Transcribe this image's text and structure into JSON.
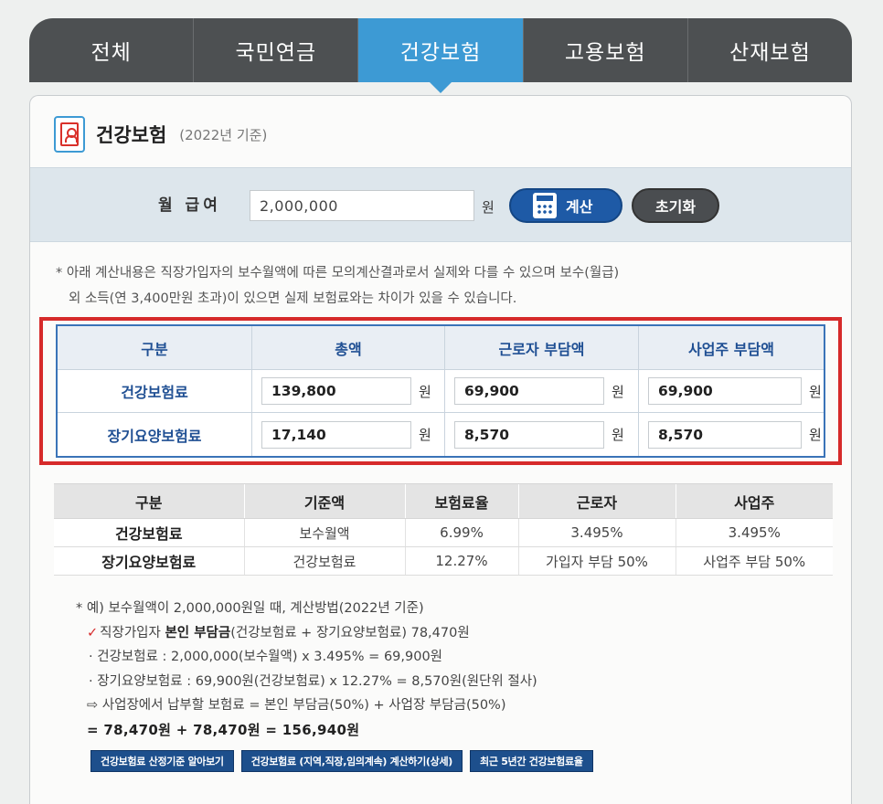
{
  "tabs": [
    {
      "label": "전체",
      "active": false
    },
    {
      "label": "국민연금",
      "active": false
    },
    {
      "label": "건강보험",
      "active": true
    },
    {
      "label": "고용보험",
      "active": false
    },
    {
      "label": "산재보험",
      "active": false
    }
  ],
  "header": {
    "title": "건강보험",
    "subtitle": "(2022년 기준)"
  },
  "calc": {
    "label": "월 급여",
    "salary_value": "2,000,000",
    "unit": "원",
    "calc_button": "계산",
    "reset_button": "초기화"
  },
  "notice": {
    "line1": "* 아래 계산내용은 직장가입자의 보수월액에 따른 모의계산결과로서 실제와 다를 수 있으며 보수(월급)",
    "line2": "외 소득(연 3,400만원 초과)이 있으면 실제 보험료와는 차이가 있을 수 있습니다."
  },
  "result": {
    "headers": [
      "구분",
      "총액",
      "근로자 부담액",
      "사업주 부담액"
    ],
    "unit": "원",
    "rows": [
      {
        "label": "건강보험료",
        "total": "139,800",
        "worker": "69,900",
        "employer": "69,900"
      },
      {
        "label": "장기요양보험료",
        "total": "17,140",
        "worker": "8,570",
        "employer": "8,570"
      }
    ]
  },
  "rates": {
    "headers": [
      "구분",
      "기준액",
      "보험료율",
      "근로자",
      "사업주"
    ],
    "rows": [
      [
        "건강보험료",
        "보수월액",
        "6.99%",
        "3.495%",
        "3.495%"
      ],
      [
        "장기요양보험료",
        "건강보험료",
        "12.27%",
        "가입자 부담 50%",
        "사업주 부담 50%"
      ]
    ]
  },
  "example": {
    "line1": "* 예) 보수월액이 2,000,000원일 때, 계산방법(2022년 기준)",
    "line2_mark": "✓",
    "line2_a": "직장가입자 ",
    "line2_strong": "본인 부담금",
    "line2_b": "(건강보험료 + 장기요양보험료) 78,470원",
    "line3": "· 건강보험료 : 2,000,000(보수월액) x 3.495% = 69,900원",
    "line4": "· 장기요양보험료 : 69,900원(건강보험료) x 12.27% = 8,570원(원단위 절사)",
    "line5": "⇨ 사업장에서 납부할 보험료 = 본인 부담금(50%) + 사업장 부담금(50%)",
    "line6": "= 78,470원 + 78,470원 = 156,940원"
  },
  "bottom_buttons": [
    "건강보험료 산정기준 알아보기",
    "건강보험료 (지역,직장,임의계속) 계산하기(상세)",
    "최근 5년간 건강보험료율"
  ]
}
